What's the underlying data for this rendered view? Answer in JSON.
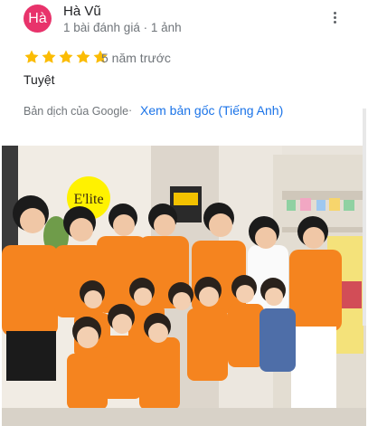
{
  "review": {
    "avatar_letter": "Hà",
    "avatar_color": "#e8336b",
    "author": "Hà Vũ",
    "meta": "1 bài đánh giá · 1 ảnh",
    "rating": 5,
    "time_ago": "5 năm trước",
    "text": "Tuyệt",
    "translated_by": "Bản dịch của Google",
    "separator": "·",
    "see_original": "Xem bản gốc (Tiếng Anh)",
    "star_color": "#fbbc04",
    "link_color": "#1a73e8"
  },
  "photo": {
    "sign_text": "E'lite",
    "logo_color": "#fff200",
    "shirt_color": "#f5841f"
  },
  "icons": {
    "more": "more-vert-icon",
    "star": "star-icon"
  }
}
